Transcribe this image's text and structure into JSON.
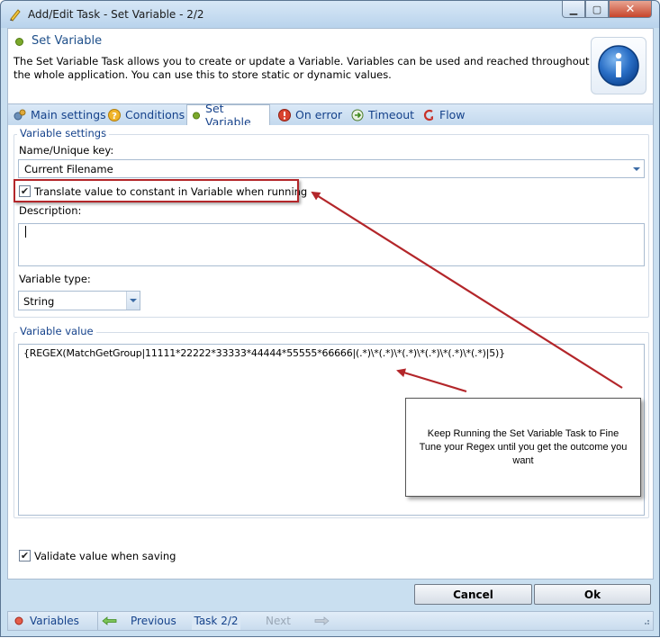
{
  "window": {
    "title": "Add/Edit Task - Set Variable - 2/2"
  },
  "header": {
    "heading": "Set Variable",
    "description": "The Set Variable Task allows you to create or update a Variable. Variables can be used and reached throughout the whole application. You can use this to store static or dynamic values."
  },
  "tabs": [
    {
      "label": "Main settings",
      "icon": "gears-icon"
    },
    {
      "label": "Conditions",
      "icon": "question-icon"
    },
    {
      "label": "Set Variable",
      "icon": "green-dot-icon",
      "active": true
    },
    {
      "label": "On error",
      "icon": "stop-icon"
    },
    {
      "label": "Timeout",
      "icon": "clock-arrow-icon"
    },
    {
      "label": "Flow",
      "icon": "flow-arrow-icon"
    }
  ],
  "variable_settings": {
    "group_title": "Variable settings",
    "name_label": "Name/Unique key:",
    "name_value": "Current Filename",
    "translate_label": "Translate value to constant in Variable when running",
    "translate_checked": true,
    "description_label": "Description:",
    "description_value": "",
    "type_label": "Variable type:",
    "type_value": "String"
  },
  "variable_value": {
    "group_title": "Variable value",
    "value": "{REGEX(MatchGetGroup|11111*22222*33333*44444*55555*66666|(.*)\\*(.*)\\*(.*)\\*(.*)\\*(.*)\\*(.*)|5)}"
  },
  "note": {
    "text": "Keep Running the Set Variable Task to Fine Tune your Regex until you get the outcome you want"
  },
  "validate": {
    "label": "Validate value when saving",
    "checked": true
  },
  "buttons": {
    "cancel": "Cancel",
    "ok": "Ok"
  },
  "statusbar": {
    "variables": "Variables",
    "previous": "Previous",
    "task": "Task 2/2",
    "next": "Next"
  },
  "colors": {
    "accent": "#15428b",
    "annotation_red": "#b3262a",
    "window_bg": "#c9dff0"
  }
}
